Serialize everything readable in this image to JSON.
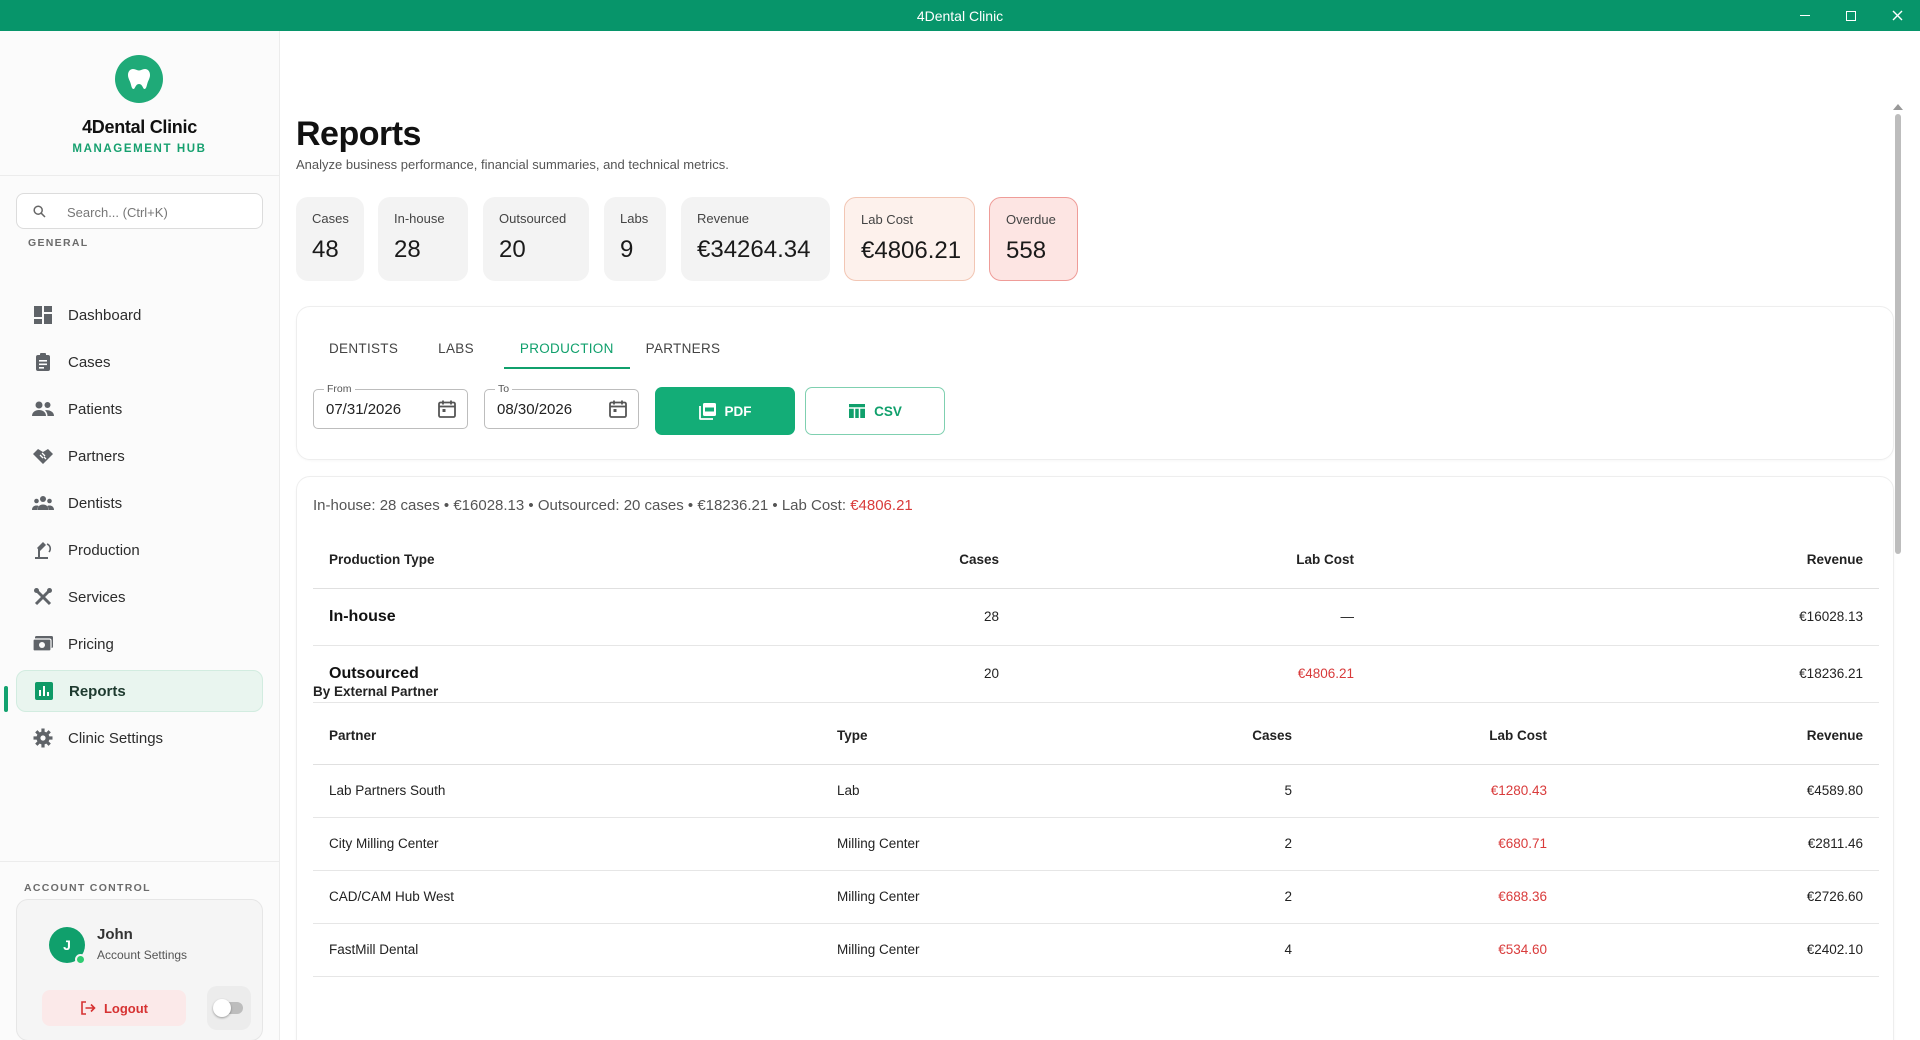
{
  "window": {
    "title": "4Dental Clinic"
  },
  "brand": {
    "name": "4Dental Clinic",
    "subtitle": "MANAGEMENT HUB"
  },
  "search": {
    "placeholder": "Search... (Ctrl+K)"
  },
  "sidebar": {
    "section_label": "GENERAL",
    "items": [
      {
        "label": "Dashboard",
        "icon": "dashboard-icon"
      },
      {
        "label": "Cases",
        "icon": "clipboard-icon"
      },
      {
        "label": "Patients",
        "icon": "people-icon"
      },
      {
        "label": "Partners",
        "icon": "handshake-icon"
      },
      {
        "label": "Dentists",
        "icon": "group-icon"
      },
      {
        "label": "Production",
        "icon": "microscope-icon"
      },
      {
        "label": "Services",
        "icon": "tools-icon"
      },
      {
        "label": "Pricing",
        "icon": "money-icon"
      },
      {
        "label": "Reports",
        "icon": "bar-chart-icon",
        "active": true
      },
      {
        "label": "Clinic Settings",
        "icon": "gear-icon"
      }
    ]
  },
  "account": {
    "section_label": "ACCOUNT CONTROL",
    "initial": "J",
    "name": "John",
    "subtitle": "Account Settings",
    "logout_label": "Logout"
  },
  "page": {
    "title": "Reports",
    "subtitle": "Analyze business performance, financial summaries, and technical metrics."
  },
  "stats": [
    {
      "label": "Cases",
      "value": "48"
    },
    {
      "label": "In-house",
      "value": "28"
    },
    {
      "label": "Outsourced",
      "value": "20"
    },
    {
      "label": "Labs",
      "value": "9"
    },
    {
      "label": "Revenue",
      "value": "€34264.34"
    },
    {
      "label": "Lab Cost",
      "value": "€4806.21"
    },
    {
      "label": "Overdue",
      "value": "558"
    }
  ],
  "tabs": [
    "DENTISTS",
    "LABS",
    "PRODUCTION",
    "PARTNERS"
  ],
  "active_tab": "PRODUCTION",
  "filters": {
    "from_label": "From",
    "from_value": "07/31/2026",
    "to_label": "To",
    "to_value": "08/30/2026",
    "pdf_label": "PDF",
    "csv_label": "CSV"
  },
  "summary": {
    "text": "In-house: 28 cases • €16028.13 • Outsourced: 20 cases • €18236.21 • Lab Cost: ",
    "lab_cost": "€4806.21"
  },
  "production_table": {
    "headers": [
      "Production Type",
      "Cases",
      "Lab Cost",
      "Revenue"
    ],
    "rows": [
      {
        "type": "In-house",
        "cases": "28",
        "lab_cost": "—",
        "revenue": "€16028.13"
      },
      {
        "type": "Outsourced",
        "cases": "20",
        "lab_cost": "€4806.21",
        "revenue": "€18236.21"
      }
    ]
  },
  "partners_section": {
    "title": "By External Partner",
    "headers": [
      "Partner",
      "Type",
      "Cases",
      "Lab Cost",
      "Revenue"
    ],
    "rows": [
      {
        "partner": "Lab Partners South",
        "type": "Lab",
        "cases": "5",
        "lab_cost": "€1280.43",
        "revenue": "€4589.80"
      },
      {
        "partner": "City Milling Center",
        "type": "Milling Center",
        "cases": "2",
        "lab_cost": "€680.71",
        "revenue": "€2811.46"
      },
      {
        "partner": "CAD/CAM Hub West",
        "type": "Milling Center",
        "cases": "2",
        "lab_cost": "€688.36",
        "revenue": "€2726.60"
      },
      {
        "partner": "FastMill Dental",
        "type": "Milling Center",
        "cases": "4",
        "lab_cost": "€534.60",
        "revenue": "€2402.10"
      }
    ]
  },
  "colors": {
    "accent": "#10a06c",
    "titlebar": "#07956a",
    "danger": "#d93b3b"
  }
}
